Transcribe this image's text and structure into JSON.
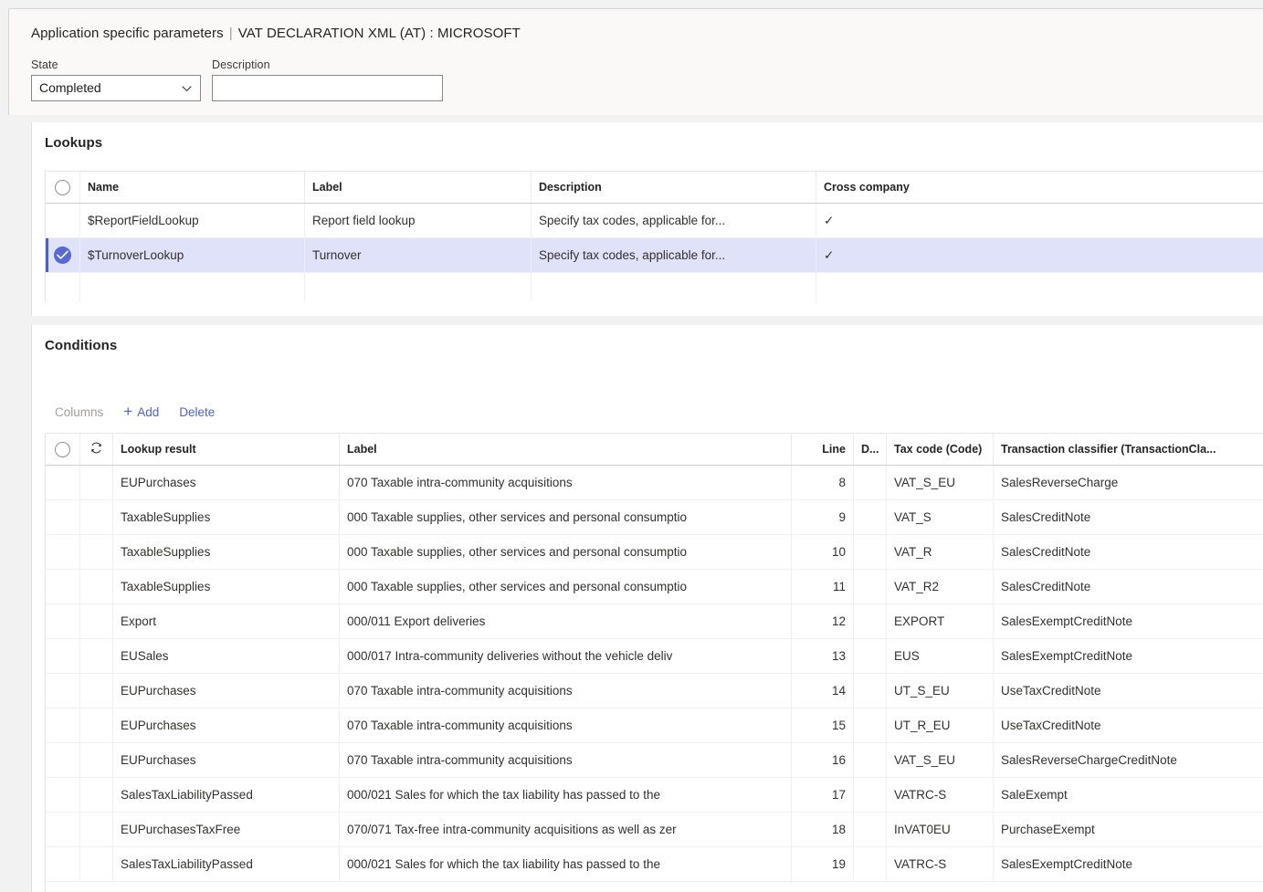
{
  "header": {
    "title": "Application specific parameters",
    "separator": "|",
    "subtitle": "VAT DECLARATION XML (AT) : MICROSOFT",
    "state": {
      "label": "State",
      "value": "Completed"
    },
    "description": {
      "label": "Description",
      "value": "",
      "placeholder": ""
    }
  },
  "lookups": {
    "title": "Lookups",
    "columns": [
      "Name",
      "Label",
      "Description",
      "Cross company"
    ],
    "rows": [
      {
        "selected": false,
        "name": "$ReportFieldLookup",
        "label": "Report field lookup",
        "description": "Specify tax codes, applicable for...",
        "cross_company": "✓"
      },
      {
        "selected": true,
        "name": "$TurnoverLookup",
        "label": "Turnover",
        "description": "Specify tax codes, applicable for...",
        "cross_company": "✓"
      }
    ]
  },
  "conditions": {
    "title": "Conditions",
    "toolbar": {
      "columns_label": "Columns",
      "add_label": "Add",
      "delete_label": "Delete"
    },
    "columns": [
      "Lookup result",
      "Label",
      "Line",
      "D...",
      "Tax code (Code)",
      "Transaction classifier (TransactionCla..."
    ],
    "rows": [
      {
        "lookup_result": "EUPurchases",
        "label": "070 Taxable intra-community acquisitions",
        "line": "8",
        "d": "",
        "tax_code": "VAT_S_EU",
        "transaction_classifier": "SalesReverseCharge"
      },
      {
        "lookup_result": "TaxableSupplies",
        "label": "000 Taxable supplies, other services and personal consumptio",
        "line": "9",
        "d": "",
        "tax_code": "VAT_S",
        "transaction_classifier": "SalesCreditNote"
      },
      {
        "lookup_result": "TaxableSupplies",
        "label": "000 Taxable supplies, other services and personal consumptio",
        "line": "10",
        "d": "",
        "tax_code": "VAT_R",
        "transaction_classifier": "SalesCreditNote"
      },
      {
        "lookup_result": "TaxableSupplies",
        "label": "000 Taxable supplies, other services and personal consumptio",
        "line": "11",
        "d": "",
        "tax_code": "VAT_R2",
        "transaction_classifier": "SalesCreditNote"
      },
      {
        "lookup_result": "Export",
        "label": "000/011 Export deliveries",
        "line": "12",
        "d": "",
        "tax_code": "EXPORT",
        "transaction_classifier": "SalesExemptCreditNote"
      },
      {
        "lookup_result": "EUSales",
        "label": "000/017 Intra-community deliveries without the vehicle deliv",
        "line": "13",
        "d": "",
        "tax_code": "EUS",
        "transaction_classifier": "SalesExemptCreditNote"
      },
      {
        "lookup_result": "EUPurchases",
        "label": "070 Taxable intra-community acquisitions",
        "line": "14",
        "d": "",
        "tax_code": "UT_S_EU",
        "transaction_classifier": "UseTaxCreditNote"
      },
      {
        "lookup_result": "EUPurchases",
        "label": "070 Taxable intra-community acquisitions",
        "line": "15",
        "d": "",
        "tax_code": "UT_R_EU",
        "transaction_classifier": "UseTaxCreditNote"
      },
      {
        "lookup_result": "EUPurchases",
        "label": "070 Taxable intra-community acquisitions",
        "line": "16",
        "d": "",
        "tax_code": "VAT_S_EU",
        "transaction_classifier": "SalesReverseChargeCreditNote"
      },
      {
        "lookup_result": "SalesTaxLiabilityPassed",
        "label": "000/021 Sales for which the tax liability has passed to the",
        "line": "17",
        "d": "",
        "tax_code": "VATRC-S",
        "transaction_classifier": "SaleExempt"
      },
      {
        "lookup_result": "EUPurchasesTaxFree",
        "label": "070/071 Tax-free intra-community acquisitions as well as zer",
        "line": "18",
        "d": "",
        "tax_code": "InVAT0EU",
        "transaction_classifier": "PurchaseExempt"
      },
      {
        "lookup_result": "SalesTaxLiabilityPassed",
        "label": "000/021 Sales for which the tax liability has passed to the",
        "line": "19",
        "d": "",
        "tax_code": "VATRC-S",
        "transaction_classifier": "SalesExemptCreditNote"
      }
    ]
  },
  "colors": {
    "accent": "#4d61d2",
    "selection_row": "#dfe2f8",
    "selection_bar": "#4f5fc9",
    "page_background": "#f2f2f2",
    "header_background": "#faf9f8"
  }
}
